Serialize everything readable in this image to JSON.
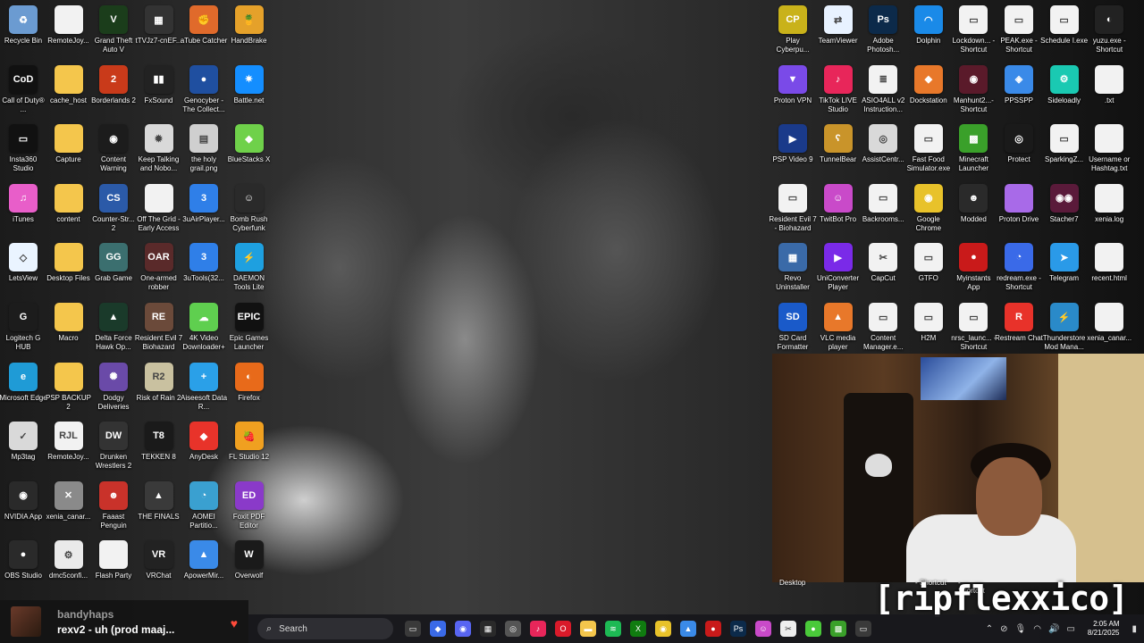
{
  "desktop_icons": [
    {
      "label": "Recycle Bin",
      "icon": "recycle-bin-icon",
      "color": "#6b9bd1",
      "glyph": "♻"
    },
    {
      "label": "RemoteJoy...",
      "icon": "file-icon",
      "color": "#f2f2f2",
      "glyph": ""
    },
    {
      "label": "Grand Theft Auto V",
      "icon": "gta-icon",
      "color": "#1b3d1b",
      "glyph": "V"
    },
    {
      "label": "tTVJz7-cnEF...",
      "icon": "image-file-icon",
      "color": "#333333",
      "glyph": "▦"
    },
    {
      "label": "aTube Catcher",
      "icon": "atube-icon",
      "color": "#e06a2b",
      "glyph": "✊"
    },
    {
      "label": "HandBrake",
      "icon": "handbrake-icon",
      "color": "#e5a12a",
      "glyph": "🍍"
    },
    {
      "label": "Call of Duty® ...",
      "icon": "call-of-duty-icon",
      "color": "#111111",
      "glyph": "CoD"
    },
    {
      "label": "cache_host",
      "icon": "folder-icon",
      "color": "#f4c64c",
      "glyph": ""
    },
    {
      "label": "Borderlands 2",
      "icon": "borderlands-icon",
      "color": "#c93a1a",
      "glyph": "2"
    },
    {
      "label": "FxSound",
      "icon": "fxsound-icon",
      "color": "#222222",
      "glyph": "▮▮"
    },
    {
      "label": "Genocyber - The Collect...",
      "icon": "media-file-icon",
      "color": "#1f4fa0",
      "glyph": "●"
    },
    {
      "label": "Battle.net",
      "icon": "battlenet-icon",
      "color": "#148eff",
      "glyph": "✷"
    },
    {
      "label": "Insta360 Studio",
      "icon": "insta360-icon",
      "color": "#111111",
      "glyph": "▭"
    },
    {
      "label": "Capture",
      "icon": "folder-icon",
      "color": "#f4c64c",
      "glyph": ""
    },
    {
      "label": "Content Warning",
      "icon": "content-warning-icon",
      "color": "#1c1c1c",
      "glyph": "◉"
    },
    {
      "label": "Keep Talking and Nobo...",
      "icon": "keep-talking-icon",
      "color": "#d9d9d9",
      "glyph": "✹"
    },
    {
      "label": "the holy grail.png",
      "icon": "image-file-icon",
      "color": "#cfcfcf",
      "glyph": "▤"
    },
    {
      "label": "BlueStacks X",
      "icon": "bluestacks-icon",
      "color": "#6fd14a",
      "glyph": "◆"
    },
    {
      "label": "iTunes",
      "icon": "itunes-icon",
      "color": "#e85ec9",
      "glyph": "♫"
    },
    {
      "label": "content",
      "icon": "folder-icon",
      "color": "#f4c64c",
      "glyph": ""
    },
    {
      "label": "Counter-Str... 2",
      "icon": "counter-strike-icon",
      "color": "#2b5aa8",
      "glyph": "CS"
    },
    {
      "label": "Off The Grid - Early Access",
      "icon": "file-icon",
      "color": "#f2f2f2",
      "glyph": ""
    },
    {
      "label": "3uAirPlayer...",
      "icon": "3uairplayer-icon",
      "color": "#2f7fe8",
      "glyph": "3"
    },
    {
      "label": "Bomb Rush Cyberfunk",
      "icon": "bomb-rush-icon",
      "color": "#2a2a2a",
      "glyph": "☺"
    },
    {
      "label": "LetsView",
      "icon": "letsview-icon",
      "color": "#eaf4ff",
      "glyph": "◇"
    },
    {
      "label": "Desktop Files",
      "icon": "folder-icon",
      "color": "#f4c64c",
      "glyph": ""
    },
    {
      "label": "Grab Game",
      "icon": "grab-game-icon",
      "color": "#3b6f6f",
      "glyph": "GG"
    },
    {
      "label": "One-armed robber",
      "icon": "one-armed-robber-icon",
      "color": "#5a2a2a",
      "glyph": "OAR"
    },
    {
      "label": "3uTools(32...",
      "icon": "3utools-icon",
      "color": "#2f7fe8",
      "glyph": "3"
    },
    {
      "label": "DAEMON Tools Lite",
      "icon": "daemon-tools-icon",
      "color": "#1ea0e0",
      "glyph": "⚡"
    },
    {
      "label": "Logitech G HUB",
      "icon": "logitech-icon",
      "color": "#1c1c1c",
      "glyph": "G"
    },
    {
      "label": "Macro",
      "icon": "folder-icon",
      "color": "#f4c64c",
      "glyph": ""
    },
    {
      "label": "Delta Force Hawk Op...",
      "icon": "delta-force-icon",
      "color": "#1a3a2a",
      "glyph": "▲"
    },
    {
      "label": "Resident Evil 7 Biohazard",
      "icon": "resident-evil-icon",
      "color": "#6b4a3a",
      "glyph": "RE"
    },
    {
      "label": "4K Video Downloader+",
      "icon": "4k-video-icon",
      "color": "#5fcf4f",
      "glyph": "☁"
    },
    {
      "label": "Epic Games Launcher",
      "icon": "epic-games-icon",
      "color": "#111111",
      "glyph": "EPIC"
    },
    {
      "label": "Microsoft Edge",
      "icon": "edge-icon",
      "color": "#1f9bd6",
      "glyph": "e"
    },
    {
      "label": "PSP BACKUP 2",
      "icon": "folder-icon",
      "color": "#f4c64c",
      "glyph": ""
    },
    {
      "label": "Dodgy Deliveries",
      "icon": "dodgy-deliveries-icon",
      "color": "#6a4aa8",
      "glyph": "✺"
    },
    {
      "label": "Risk of Rain 2",
      "icon": "risk-of-rain-icon",
      "color": "#c9c1a0",
      "glyph": "R2"
    },
    {
      "label": "Aiseesoft Data R...",
      "icon": "aiseesoft-icon",
      "color": "#2aa0e8",
      "glyph": "+"
    },
    {
      "label": "Firefox",
      "icon": "firefox-icon",
      "color": "#e86a1a",
      "glyph": "◐"
    },
    {
      "label": "Mp3tag",
      "icon": "mp3tag-icon",
      "color": "#d9d9d9",
      "glyph": "✓"
    },
    {
      "label": "RemoteJoy...",
      "icon": "remotejoy-icon",
      "color": "#f2f2f2",
      "glyph": "RJL"
    },
    {
      "label": "Drunken Wrestlers 2",
      "icon": "drunken-wrestlers-icon",
      "color": "#333333",
      "glyph": "DW"
    },
    {
      "label": "TEKKEN 8",
      "icon": "tekken-icon",
      "color": "#1a1a1a",
      "glyph": "T8"
    },
    {
      "label": "AnyDesk",
      "icon": "anydesk-icon",
      "color": "#e8332a",
      "glyph": "◆"
    },
    {
      "label": "FL Studio 12",
      "icon": "fl-studio-icon",
      "color": "#f0a020",
      "glyph": "🍓"
    },
    {
      "label": "NVIDIA App",
      "icon": "nvidia-icon",
      "color": "#2a2a2a",
      "glyph": "◉"
    },
    {
      "label": "xenia_canar...",
      "icon": "xenia-icon",
      "color": "#8a8a8a",
      "glyph": "✕"
    },
    {
      "label": "Faaast Penguin",
      "icon": "faaast-penguin-icon",
      "color": "#c9322a",
      "glyph": "☻"
    },
    {
      "label": "THE FINALS",
      "icon": "the-finals-icon",
      "color": "#3a3a3a",
      "glyph": "▲"
    },
    {
      "label": "AOMEI Partitio...",
      "icon": "aomei-icon",
      "color": "#3aa0d0",
      "glyph": "◔"
    },
    {
      "label": "Foxit PDF Editor",
      "icon": "foxit-icon",
      "color": "#8a3ac9",
      "glyph": "ED"
    },
    {
      "label": "OBS Studio",
      "icon": "obs-icon",
      "color": "#2a2a2a",
      "glyph": "●"
    },
    {
      "label": "dmc5confi...",
      "icon": "config-file-icon",
      "color": "#eaeaea",
      "glyph": "⚙"
    },
    {
      "label": "Flash Party",
      "icon": "file-icon",
      "color": "#f2f2f2",
      "glyph": ""
    },
    {
      "label": "VRChat",
      "icon": "vrchat-icon",
      "color": "#222222",
      "glyph": "VR"
    },
    {
      "label": "ApowerMir...",
      "icon": "apowermirror-icon",
      "color": "#3a8ae8",
      "glyph": "▲"
    },
    {
      "label": "Overwolf",
      "icon": "overwolf-icon",
      "color": "#1a1a1a",
      "glyph": "W"
    }
  ],
  "right_icons": [
    {
      "label": "Play Cyberpu...",
      "icon": "cyberpunk-icon",
      "color": "#c9b21a",
      "glyph": "CP"
    },
    {
      "label": "TeamViewer",
      "icon": "teamviewer-icon",
      "color": "#e8f2ff",
      "glyph": "⇄"
    },
    {
      "label": "Adobe Photosh...",
      "icon": "photoshop-icon",
      "color": "#0c2a4a",
      "glyph": "Ps"
    },
    {
      "label": "Dolphin",
      "icon": "dolphin-icon",
      "color": "#1a8ae8",
      "glyph": "◠"
    },
    {
      "label": "Lockdown... - Shortcut",
      "icon": "window-file-icon",
      "color": "#f2f2f2",
      "glyph": "▭"
    },
    {
      "label": "PEAK.exe - Shortcut",
      "icon": "window-file-icon",
      "color": "#f2f2f2",
      "glyph": "▭"
    },
    {
      "label": "Schedule I.exe",
      "icon": "window-file-icon",
      "color": "#f2f2f2",
      "glyph": "▭"
    },
    {
      "label": "yuzu.exe - Shortcut",
      "icon": "yuzu-icon",
      "color": "#222222",
      "glyph": "◐"
    },
    {
      "label": "Proton VPN",
      "icon": "protonvpn-icon",
      "color": "#7a4ae8",
      "glyph": "▼"
    },
    {
      "label": "TikTok LIVE Studio",
      "icon": "tiktok-icon",
      "color": "#e8265a",
      "glyph": "♪"
    },
    {
      "label": "ASIO4ALL v2 Instruction...",
      "icon": "document-icon",
      "color": "#f2f2f2",
      "glyph": "≣"
    },
    {
      "label": "Dockstation",
      "icon": "dockstation-icon",
      "color": "#e8782a",
      "glyph": "◆"
    },
    {
      "label": "Manhunt2...- Shortcut",
      "icon": "manhunt-icon",
      "color": "#5a1a2a",
      "glyph": "◉"
    },
    {
      "label": "PPSSPP",
      "icon": "ppsspp-icon",
      "color": "#3a8ae8",
      "glyph": "◈"
    },
    {
      "label": "Sideloadly",
      "icon": "sideloadly-icon",
      "color": "#1ac9b2",
      "glyph": "⚙"
    },
    {
      "label": ".txt",
      "icon": "text-file-icon",
      "color": "#f2f2f2",
      "glyph": ""
    },
    {
      "label": "PSP Video 9",
      "icon": "psp-video-icon",
      "color": "#1a3a8a",
      "glyph": "▶"
    },
    {
      "label": "TunnelBear",
      "icon": "tunnelbear-icon",
      "color": "#c9942a",
      "glyph": "ʕ"
    },
    {
      "label": "AssistCentr...",
      "icon": "assistcenter-icon",
      "color": "#d9d9d9",
      "glyph": "◎"
    },
    {
      "label": "Fast Food Simulator.exe",
      "icon": "window-file-icon",
      "color": "#f2f2f2",
      "glyph": "▭"
    },
    {
      "label": "Minecraft Launcher",
      "icon": "minecraft-icon",
      "color": "#3aa02a",
      "glyph": "▩"
    },
    {
      "label": "Protect",
      "icon": "fingerprint-icon",
      "color": "#1a1a1a",
      "glyph": "◎"
    },
    {
      "label": "SparkingZ...",
      "icon": "window-file-icon",
      "color": "#f2f2f2",
      "glyph": "▭"
    },
    {
      "label": "Username or Hashtag.txt",
      "icon": "text-file-icon",
      "color": "#f2f2f2",
      "glyph": ""
    },
    {
      "label": "Resident Evil 7 - Biohazard",
      "icon": "window-file-icon",
      "color": "#f2f2f2",
      "glyph": "▭"
    },
    {
      "label": "TwitBot Pro",
      "icon": "twitbot-icon",
      "color": "#c94ac9",
      "glyph": "☺"
    },
    {
      "label": "Backrooms...",
      "icon": "window-file-icon",
      "color": "#f2f2f2",
      "glyph": "▭"
    },
    {
      "label": "Google Chrome",
      "icon": "chrome-icon",
      "color": "#e8c22a",
      "glyph": "◉"
    },
    {
      "label": "Modded",
      "icon": "modded-icon",
      "color": "#2a2a2a",
      "glyph": "☻"
    },
    {
      "label": "Proton Drive",
      "icon": "folder-icon",
      "color": "#a86ae8",
      "glyph": ""
    },
    {
      "label": "Stacher7",
      "icon": "stacher-icon",
      "color": "#5a1a3a",
      "glyph": "◉◉"
    },
    {
      "label": "xenia.log",
      "icon": "text-file-icon",
      "color": "#f2f2f2",
      "glyph": ""
    },
    {
      "label": "Revo Uninstaller",
      "icon": "revo-icon",
      "color": "#3a6aa8",
      "glyph": "▦"
    },
    {
      "label": "UniConverter Player",
      "icon": "uniconverter-icon",
      "color": "#7a2ae8",
      "glyph": "▶"
    },
    {
      "label": "CapCut",
      "icon": "capcut-icon",
      "color": "#f2f2f2",
      "glyph": "✂"
    },
    {
      "label": "GTFO",
      "icon": "window-file-icon",
      "color": "#f2f2f2",
      "glyph": "▭"
    },
    {
      "label": "Myinstants App",
      "icon": "myinstants-icon",
      "color": "#c91a1a",
      "glyph": "●"
    },
    {
      "label": "redream.exe - Shortcut",
      "icon": "redream-icon",
      "color": "#3a6ae8",
      "glyph": "◔"
    },
    {
      "label": "Telegram",
      "icon": "telegram-icon",
      "color": "#2a9ae8",
      "glyph": "➤"
    },
    {
      "label": "recent.html",
      "icon": "html-file-icon",
      "color": "#f2f2f2",
      "glyph": ""
    },
    {
      "label": "SD Card Formatter",
      "icon": "sd-card-icon",
      "color": "#1a5ac9",
      "glyph": "SD"
    },
    {
      "label": "VLC media player",
      "icon": "vlc-icon",
      "color": "#e8782a",
      "glyph": "▲"
    },
    {
      "label": "Content Manager.e...",
      "icon": "window-file-icon",
      "color": "#f2f2f2",
      "glyph": "▭"
    },
    {
      "label": "H2M",
      "icon": "window-file-icon",
      "color": "#f2f2f2",
      "glyph": "▭"
    },
    {
      "label": "nrsc_launc... - Shortcut",
      "icon": "window-file-icon",
      "color": "#f2f2f2",
      "glyph": "▭"
    },
    {
      "label": "Restream Chat",
      "icon": "restream-icon",
      "color": "#e8322a",
      "glyph": "R"
    },
    {
      "label": "Thunderstore Mod Mana...",
      "icon": "thunderstore-icon",
      "color": "#2a8ac9",
      "glyph": "⚡"
    },
    {
      "label": "xenia_canar...",
      "icon": "text-file-icon",
      "color": "#f2f2f2",
      "glyph": ""
    }
  ],
  "webcam_labels": {
    "desktop": "Desktop",
    "shortcut1": "- Shortcut",
    "shortcut2": "- Shortcut"
  },
  "overlay_name": "[ripflexxico]",
  "now_playing": {
    "artist": "bandyhaps",
    "track": "rexv2 - uh (prod maaj..."
  },
  "taskbar": {
    "search_placeholder": "Search",
    "apps": [
      {
        "name": "task-view-icon",
        "color": "#3a3a3a",
        "glyph": "▭"
      },
      {
        "name": "copilot-icon",
        "color": "#3a6ae8",
        "glyph": "◆"
      },
      {
        "name": "discord-icon",
        "color": "#5865f2",
        "glyph": "◉"
      },
      {
        "name": "media-icon",
        "color": "#2a2a2a",
        "glyph": "▦"
      },
      {
        "name": "chrome-alt-icon",
        "color": "#555555",
        "glyph": "◎"
      },
      {
        "name": "tiktok-taskbar-icon",
        "color": "#e8265a",
        "glyph": "♪"
      },
      {
        "name": "opera-icon",
        "color": "#d91a2a",
        "glyph": "O"
      },
      {
        "name": "file-explorer-icon",
        "color": "#f4c64c",
        "glyph": "▬"
      },
      {
        "name": "spotify-icon",
        "color": "#1db954",
        "glyph": "≋"
      },
      {
        "name": "xbox-icon",
        "color": "#107c10",
        "glyph": "X"
      },
      {
        "name": "chrome-taskbar-icon",
        "color": "#e8c22a",
        "glyph": "◉"
      },
      {
        "name": "photos-icon",
        "color": "#3a8ae8",
        "glyph": "▲"
      },
      {
        "name": "red-app-icon",
        "color": "#c91a1a",
        "glyph": "●"
      },
      {
        "name": "photoshop-taskbar-icon",
        "color": "#0c2a4a",
        "glyph": "Ps"
      },
      {
        "name": "twitbot-taskbar-icon",
        "color": "#c94ac9",
        "glyph": "☺"
      },
      {
        "name": "capcut-taskbar-icon",
        "color": "#eeeeee",
        "glyph": "✂"
      },
      {
        "name": "green-app-icon",
        "color": "#4ac93a",
        "glyph": "●"
      },
      {
        "name": "minecraft-taskbar-icon",
        "color": "#3aa02a",
        "glyph": "▩"
      },
      {
        "name": "screen-icon",
        "color": "#3a3a3a",
        "glyph": "▭"
      }
    ],
    "time": "2:05 AM",
    "date": "8/21/2025"
  }
}
